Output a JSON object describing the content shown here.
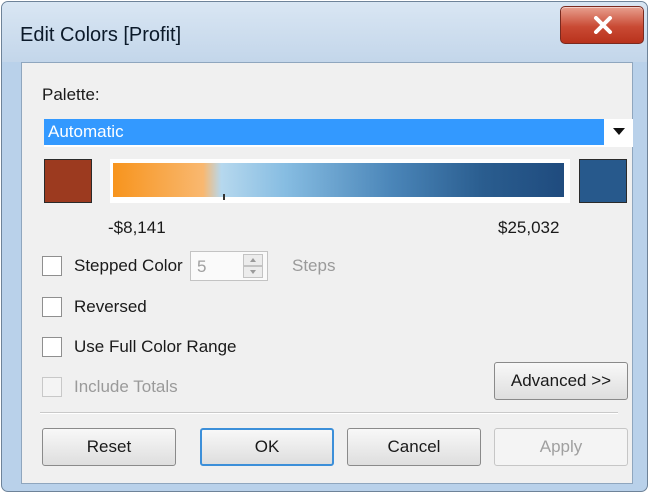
{
  "window": {
    "title": "Edit Colors [Profit]"
  },
  "palette": {
    "label": "Palette:",
    "selected": "Automatic",
    "start_color": "#9c3a1f",
    "end_color": "#27598c",
    "min_label": "-$8,141",
    "max_label": "$25,032"
  },
  "stepped_color": {
    "label": "Stepped Color",
    "checked": false,
    "steps_value": "5",
    "steps_label": "Steps"
  },
  "reversed": {
    "label": "Reversed",
    "checked": false
  },
  "full_range": {
    "label": "Use Full Color Range",
    "checked": false
  },
  "include_totals": {
    "label": "Include Totals",
    "checked": false,
    "disabled": true
  },
  "buttons": {
    "advanced": "Advanced >>",
    "reset": "Reset",
    "ok": "OK",
    "cancel": "Cancel",
    "apply": "Apply"
  },
  "icons": {
    "close": "close-icon",
    "dropdown": "chevron-down-icon",
    "spin_up": "spin-up-icon",
    "spin_down": "spin-down-icon"
  }
}
